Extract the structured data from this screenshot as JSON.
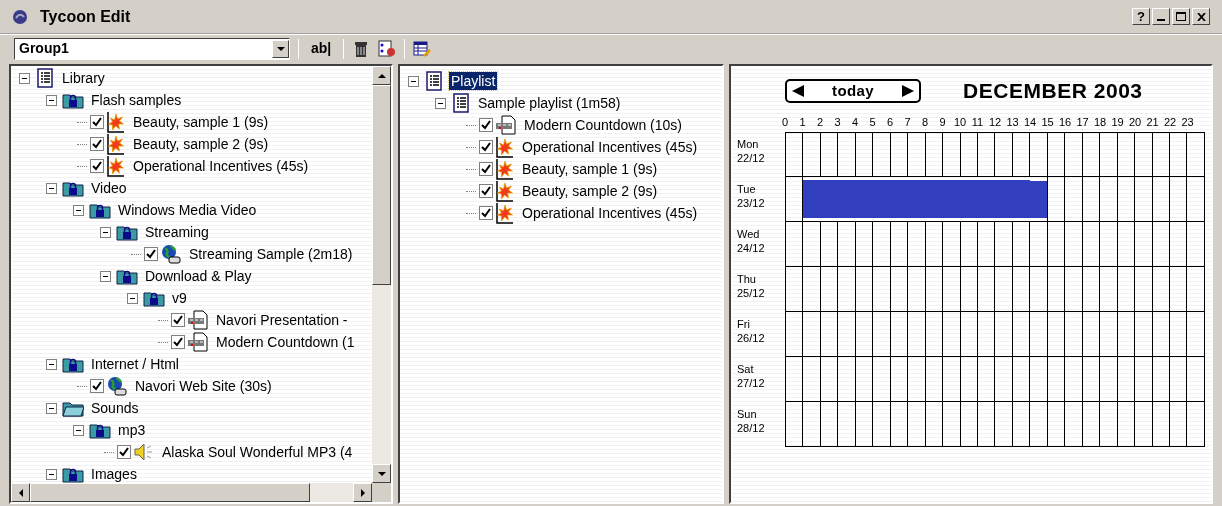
{
  "window": {
    "title": "Tycoon Edit",
    "help_button": "?"
  },
  "toolbar": {
    "group_select": "Group1",
    "text_button": "ab|"
  },
  "library_tree": [
    {
      "label": "Library",
      "kind": "list",
      "expanded": true,
      "selected": false,
      "children": [
        {
          "label": "Flash samples",
          "kind": "folder",
          "expanded": true,
          "selected": false,
          "children": [
            {
              "label": "Beauty, sample 1 (9s)",
              "kind": "flash",
              "checked": true,
              "selected": false
            },
            {
              "label": "Beauty, sample 2 (9s)",
              "kind": "flash",
              "checked": true,
              "selected": false
            },
            {
              "label": "Operational Incentives (45s)",
              "kind": "flash",
              "checked": true,
              "selected": false
            }
          ]
        },
        {
          "label": "Video",
          "kind": "folder",
          "expanded": true,
          "selected": false,
          "children": [
            {
              "label": "Windows Media Video",
              "kind": "folder",
              "expanded": true,
              "selected": false,
              "children": [
                {
                  "label": "Streaming",
                  "kind": "folder",
                  "expanded": true,
                  "selected": false,
                  "children": [
                    {
                      "label": "Streaming Sample (2m18)",
                      "kind": "web",
                      "checked": true,
                      "selected": false
                    }
                  ]
                },
                {
                  "label": "Download & Play",
                  "kind": "folder",
                  "expanded": true,
                  "selected": false,
                  "children": [
                    {
                      "label": "v9",
                      "kind": "folder",
                      "expanded": true,
                      "selected": false,
                      "children": [
                        {
                          "label": "Navori Presentation -",
                          "kind": "video",
                          "checked": true,
                          "selected": false
                        },
                        {
                          "label": "Modern Countdown (1",
                          "kind": "video",
                          "checked": true,
                          "selected": false
                        }
                      ]
                    }
                  ]
                }
              ]
            }
          ]
        },
        {
          "label": "Internet / Html",
          "kind": "folder",
          "expanded": true,
          "selected": false,
          "children": [
            {
              "label": "Navori Web Site (30s)",
              "kind": "web",
              "checked": true,
              "selected": false
            }
          ]
        },
        {
          "label": "Sounds",
          "kind": "open-folder",
          "expanded": true,
          "selected": false,
          "children": [
            {
              "label": "mp3",
              "kind": "folder",
              "expanded": true,
              "selected": false,
              "children": [
                {
                  "label": "Alaska Soul Wonderful MP3 (4",
                  "kind": "sound",
                  "checked": true,
                  "selected": false
                }
              ]
            }
          ]
        },
        {
          "label": "Images",
          "kind": "folder",
          "expanded": true,
          "selected": false
        }
      ]
    }
  ],
  "playlist_tree": [
    {
      "label": "Playlist",
      "kind": "list",
      "expanded": true,
      "selected": true,
      "children": [
        {
          "label": "Sample playlist (1m58)",
          "kind": "list",
          "expanded": true,
          "selected": false,
          "children": [
            {
              "label": "Modern Countdown (10s)",
              "kind": "video",
              "checked": true,
              "selected": false
            },
            {
              "label": "Operational Incentives (45s)",
              "kind": "flash",
              "checked": true,
              "selected": false
            },
            {
              "label": "Beauty, sample 1 (9s)",
              "kind": "flash",
              "checked": true,
              "selected": false
            },
            {
              "label": "Beauty, sample 2 (9s)",
              "kind": "flash",
              "checked": true,
              "selected": false
            },
            {
              "label": "Operational Incentives (45s)",
              "kind": "flash",
              "checked": true,
              "selected": false
            }
          ]
        }
      ]
    }
  ],
  "schedule": {
    "nav_label": "today",
    "month_title": "DECEMBER 2003",
    "hours": [
      "0",
      "1",
      "2",
      "3",
      "4",
      "5",
      "6",
      "7",
      "8",
      "9",
      "10",
      "11",
      "12",
      "13",
      "14",
      "15",
      "16",
      "17",
      "18",
      "19",
      "20",
      "21",
      "22",
      "23"
    ],
    "days": [
      {
        "name": "Mon",
        "date": "22/12",
        "slots": [
          false,
          false,
          false,
          false,
          false,
          false,
          false,
          false,
          false,
          false,
          false,
          false,
          false,
          false,
          false,
          false,
          false,
          false,
          false,
          false,
          false,
          false,
          false,
          false
        ]
      },
      {
        "name": "Tue",
        "date": "23/12",
        "slots": [
          false,
          true,
          true,
          true,
          true,
          true,
          true,
          true,
          true,
          true,
          true,
          true,
          true,
          true,
          true,
          false,
          false,
          false,
          false,
          false,
          false,
          false,
          false,
          false
        ]
      },
      {
        "name": "Wed",
        "date": "24/12",
        "slots": [
          false,
          false,
          false,
          false,
          false,
          false,
          false,
          false,
          false,
          false,
          false,
          false,
          false,
          false,
          false,
          false,
          false,
          false,
          false,
          false,
          false,
          false,
          false,
          false
        ]
      },
      {
        "name": "Thu",
        "date": "25/12",
        "slots": [
          false,
          false,
          false,
          false,
          false,
          false,
          false,
          false,
          false,
          false,
          false,
          false,
          false,
          false,
          false,
          false,
          false,
          false,
          false,
          false,
          false,
          false,
          false,
          false
        ]
      },
      {
        "name": "Fri",
        "date": "26/12",
        "slots": [
          false,
          false,
          false,
          false,
          false,
          false,
          false,
          false,
          false,
          false,
          false,
          false,
          false,
          false,
          false,
          false,
          false,
          false,
          false,
          false,
          false,
          false,
          false,
          false
        ]
      },
      {
        "name": "Sat",
        "date": "27/12",
        "slots": [
          false,
          false,
          false,
          false,
          false,
          false,
          false,
          false,
          false,
          false,
          false,
          false,
          false,
          false,
          false,
          false,
          false,
          false,
          false,
          false,
          false,
          false,
          false,
          false
        ]
      },
      {
        "name": "Sun",
        "date": "28/12",
        "slots": [
          false,
          false,
          false,
          false,
          false,
          false,
          false,
          false,
          false,
          false,
          false,
          false,
          false,
          false,
          false,
          false,
          false,
          false,
          false,
          false,
          false,
          false,
          false,
          false
        ]
      }
    ]
  }
}
